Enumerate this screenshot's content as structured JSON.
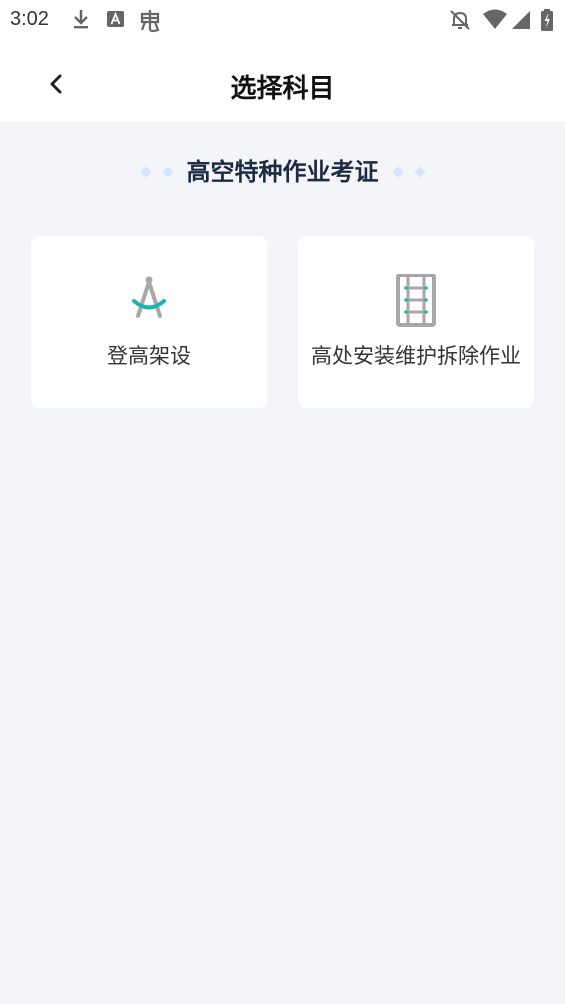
{
  "status_bar": {
    "time": "3:02",
    "left_icons": [
      "download-icon",
      "a-icon",
      "bug-icon"
    ],
    "right_icons": [
      "bell-off-icon",
      "wifi-icon",
      "signal-icon",
      "battery-icon"
    ]
  },
  "nav": {
    "back_icon": "chevron-left-icon",
    "title": "选择科目"
  },
  "section": {
    "title": "高空特种作业考证"
  },
  "subjects": [
    {
      "label": "登高架设",
      "icon": "compass-icon",
      "accent": "#1db5b0"
    },
    {
      "label": "高处安装维护拆除作业",
      "icon": "ladder-icon",
      "accent": "#1db5b0"
    }
  ],
  "colors": {
    "background": "#f4f5f8",
    "card": "#ffffff",
    "section_title": "#1d2a44",
    "diamond": "#d6e4fb",
    "icon_gray": "#a8a8a8"
  }
}
